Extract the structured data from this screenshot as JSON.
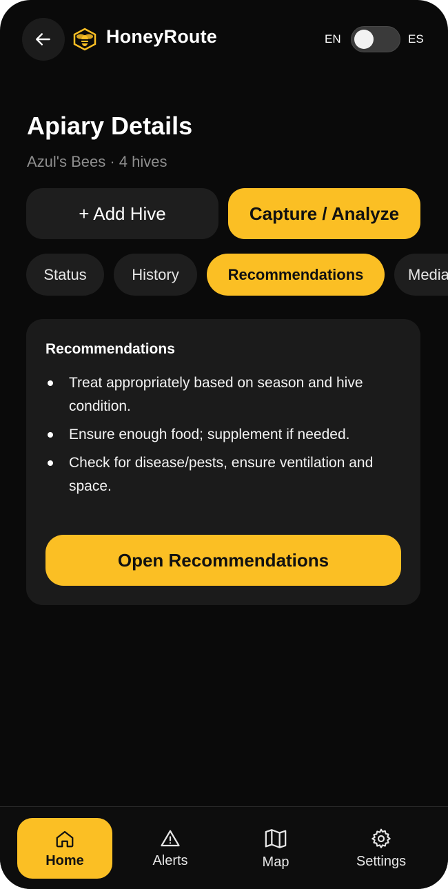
{
  "header": {
    "app_title": "HoneyRoute",
    "lang_left": "EN",
    "lang_right": "ES",
    "language_toggle_on": false
  },
  "page": {
    "title": "Apiary Details",
    "subtitle": "Azul's Bees · 4 hives"
  },
  "actions": {
    "add_hive": "+ Add Hive",
    "capture": "Capture / Analyze"
  },
  "tabs": [
    {
      "label": "Status",
      "active": false
    },
    {
      "label": "History",
      "active": false
    },
    {
      "label": "Recommendations",
      "active": true
    },
    {
      "label": "Media",
      "active": false
    }
  ],
  "card": {
    "title": "Recommendations",
    "items": [
      "Treat appropriately based on season and hive condition.",
      "Ensure enough food; supplement if needed.",
      "Check for disease/pests, ensure ventilation and space."
    ],
    "open_button": "Open Recommendations"
  },
  "nav": {
    "items": [
      {
        "label": "Home",
        "icon": "home-icon",
        "active": true
      },
      {
        "label": "Alerts",
        "icon": "alert-triangle-icon",
        "active": false
      },
      {
        "label": "Map",
        "icon": "map-icon",
        "active": false
      },
      {
        "label": "Settings",
        "icon": "gear-icon",
        "active": false
      }
    ]
  },
  "colors": {
    "accent": "#fbbf24",
    "background": "#0a0a0a",
    "surface": "#1b1b1b"
  }
}
